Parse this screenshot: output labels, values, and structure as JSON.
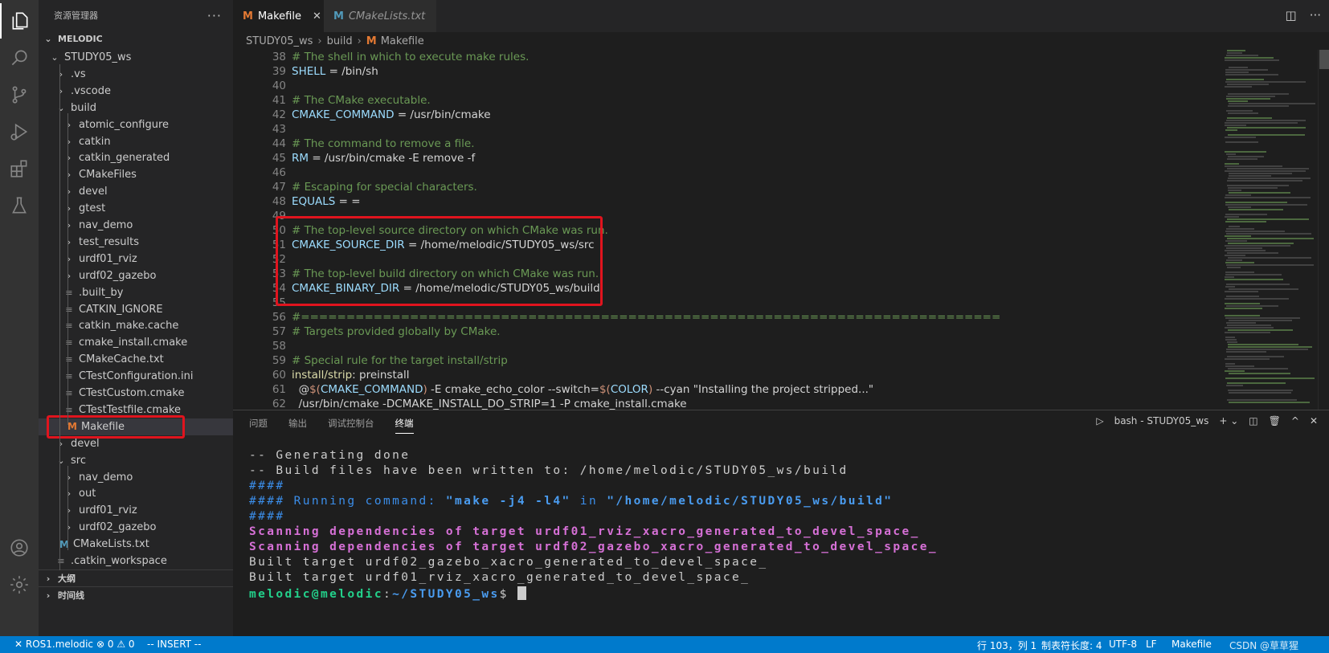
{
  "activity_bar": {
    "icons": [
      "explorer-icon",
      "search-icon",
      "source-control-icon",
      "run-debug-icon",
      "extensions-icon",
      "testing-icon",
      "account-icon",
      "settings-gear-icon"
    ]
  },
  "sidebar": {
    "title": "资源管理器",
    "more": "···",
    "workspace": "MELODIC",
    "tree": [
      {
        "label": "STUDY05_ws",
        "chev": "⌄",
        "depth": 1
      },
      {
        "label": ".vs",
        "chev": "›",
        "depth": 2
      },
      {
        "label": ".vscode",
        "chev": "›",
        "depth": 2
      },
      {
        "label": "build",
        "chev": "⌄",
        "depth": 2
      },
      {
        "label": "atomic_configure",
        "chev": "›",
        "depth": 3
      },
      {
        "label": "catkin",
        "chev": "›",
        "depth": 3
      },
      {
        "label": "catkin_generated",
        "chev": "›",
        "depth": 3
      },
      {
        "label": "CMakeFiles",
        "chev": "›",
        "depth": 3
      },
      {
        "label": "devel",
        "chev": "›",
        "depth": 3
      },
      {
        "label": "gtest",
        "chev": "›",
        "depth": 3
      },
      {
        "label": "nav_demo",
        "chev": "›",
        "depth": 3
      },
      {
        "label": "test_results",
        "chev": "›",
        "depth": 3
      },
      {
        "label": "urdf01_rviz",
        "chev": "›",
        "depth": 3
      },
      {
        "label": "urdf02_gazebo",
        "chev": "›",
        "depth": 3
      },
      {
        "label": ".built_by",
        "chev": "≡",
        "depth": 3
      },
      {
        "label": "CATKIN_IGNORE",
        "chev": "≡",
        "depth": 3
      },
      {
        "label": "catkin_make.cache",
        "chev": "≡",
        "depth": 3
      },
      {
        "label": "cmake_install.cmake",
        "chev": "≡",
        "depth": 3
      },
      {
        "label": "CMakeCache.txt",
        "chev": "≡",
        "depth": 3
      },
      {
        "label": "CTestConfiguration.ini",
        "chev": "≡",
        "depth": 3
      },
      {
        "label": "CTestCustom.cmake",
        "chev": "≡",
        "depth": 3
      },
      {
        "label": "CTestTestfile.cmake",
        "chev": "≡",
        "depth": 3
      },
      {
        "label": "Makefile",
        "chev": "M",
        "depth": 3,
        "selected": true
      },
      {
        "label": "devel",
        "chev": "›",
        "depth": 2
      },
      {
        "label": "src",
        "chev": "⌄",
        "depth": 2
      },
      {
        "label": "nav_demo",
        "chev": "›",
        "depth": 3
      },
      {
        "label": "out",
        "chev": "›",
        "depth": 3
      },
      {
        "label": "urdf01_rviz",
        "chev": "›",
        "depth": 3
      },
      {
        "label": "urdf02_gazebo",
        "chev": "›",
        "depth": 3
      },
      {
        "label": "CMakeLists.txt",
        "chev": "M",
        "depth": 2,
        "blue": true
      },
      {
        "label": ".catkin_workspace",
        "chev": "≡",
        "depth": 2
      }
    ],
    "outline": "大纲",
    "timeline": "时间线"
  },
  "tabs": [
    {
      "label": "Makefile",
      "icon": "M",
      "active": true
    },
    {
      "label": "CMakeLists.txt",
      "icon": "M",
      "active": false
    }
  ],
  "tab_close": "✕",
  "breadcrumb": [
    "STUDY05_ws",
    "build",
    "Makefile"
  ],
  "code_lines": [
    {
      "n": "38",
      "parts": [
        {
          "t": "# The shell in which to execute make rules.",
          "c": "c-comment"
        }
      ]
    },
    {
      "n": "39",
      "parts": [
        {
          "t": "SHELL",
          "c": "c-var"
        },
        {
          "t": " = /bin/sh",
          "c": "c-plain"
        }
      ]
    },
    {
      "n": "40",
      "parts": []
    },
    {
      "n": "41",
      "parts": [
        {
          "t": "# The CMake executable.",
          "c": "c-comment"
        }
      ]
    },
    {
      "n": "42",
      "parts": [
        {
          "t": "CMAKE_COMMAND",
          "c": "c-var"
        },
        {
          "t": " = /usr/bin/cmake",
          "c": "c-plain"
        }
      ]
    },
    {
      "n": "43",
      "parts": []
    },
    {
      "n": "44",
      "parts": [
        {
          "t": "# The command to remove a file.",
          "c": "c-comment"
        }
      ]
    },
    {
      "n": "45",
      "parts": [
        {
          "t": "RM",
          "c": "c-var"
        },
        {
          "t": " = /usr/bin/cmake -E remove -f",
          "c": "c-plain"
        }
      ]
    },
    {
      "n": "46",
      "parts": []
    },
    {
      "n": "47",
      "parts": [
        {
          "t": "# Escaping for special characters.",
          "c": "c-comment"
        }
      ]
    },
    {
      "n": "48",
      "parts": [
        {
          "t": "EQUALS",
          "c": "c-var"
        },
        {
          "t": " = =",
          "c": "c-plain"
        }
      ]
    },
    {
      "n": "49",
      "parts": []
    },
    {
      "n": "50",
      "parts": [
        {
          "t": "# The top-level source directory on which CMake was run.",
          "c": "c-comment"
        }
      ]
    },
    {
      "n": "51",
      "parts": [
        {
          "t": "CMAKE_SOURCE_DIR",
          "c": "c-var"
        },
        {
          "t": " = /home/melodic/STUDY05_ws/src",
          "c": "c-plain"
        }
      ]
    },
    {
      "n": "52",
      "parts": []
    },
    {
      "n": "53",
      "parts": [
        {
          "t": "# The top-level build directory on which CMake was run.",
          "c": "c-comment"
        }
      ]
    },
    {
      "n": "54",
      "parts": [
        {
          "t": "CMAKE_BINARY_DIR",
          "c": "c-var"
        },
        {
          "t": " = /home/melodic/STUDY05_ws/build",
          "c": "c-plain"
        }
      ]
    },
    {
      "n": "55",
      "parts": []
    },
    {
      "n": "56",
      "parts": [
        {
          "t": "#=============================================================================",
          "c": "c-comment"
        }
      ]
    },
    {
      "n": "57",
      "parts": [
        {
          "t": "# Targets provided globally by CMake.",
          "c": "c-comment"
        }
      ]
    },
    {
      "n": "58",
      "parts": []
    },
    {
      "n": "59",
      "parts": [
        {
          "t": "# Special rule for the target install/strip",
          "c": "c-comment"
        }
      ]
    },
    {
      "n": "60",
      "parts": [
        {
          "t": "install/strip",
          "c": "c-macro"
        },
        {
          "t": ": preinstall",
          "c": "c-plain"
        }
      ]
    },
    {
      "n": "61",
      "parts": [
        {
          "t": "  @",
          "c": "c-plain"
        },
        {
          "t": "$(",
          "c": "c-str"
        },
        {
          "t": "CMAKE_COMMAND",
          "c": "c-var"
        },
        {
          "t": ")",
          "c": "c-str"
        },
        {
          "t": " -E cmake_echo_color --switch=",
          "c": "c-plain"
        },
        {
          "t": "$(",
          "c": "c-str"
        },
        {
          "t": "COLOR",
          "c": "c-var"
        },
        {
          "t": ")",
          "c": "c-str"
        },
        {
          "t": " --cyan \"Installing the project stripped...\"",
          "c": "c-plain"
        }
      ]
    },
    {
      "n": "62",
      "parts": [
        {
          "t": "  /usr/bin/cmake -DCMAKE_INSTALL_DO_STRIP=1 -P cmake_install.cmake",
          "c": "c-plain"
        }
      ]
    }
  ],
  "panel": {
    "tabs": [
      "问题",
      "输出",
      "调试控制台",
      "终端"
    ],
    "active_tab": "终端",
    "terminal_name": "bash - STUDY05_ws"
  },
  "terminal_lines": [
    [
      {
        "t": "-- Generating done",
        "c": "t-plain"
      }
    ],
    [
      {
        "t": "-- Build files have been written to: /home/melodic/STUDY05_ws/build",
        "c": "t-plain"
      }
    ],
    [
      {
        "t": "####",
        "c": "t-hash"
      }
    ],
    [
      {
        "t": "#### Running command: ",
        "c": "t-blue"
      },
      {
        "t": "\"make -j4 -l4\"",
        "c": "t-bold-blue"
      },
      {
        "t": " in ",
        "c": "t-blue"
      },
      {
        "t": "\"/home/melodic/STUDY05_ws/build\"",
        "c": "t-bold-blue"
      }
    ],
    [
      {
        "t": "####",
        "c": "t-hash"
      }
    ],
    [
      {
        "t": "Scanning dependencies of target urdf01_rviz_xacro_generated_to_devel_space_",
        "c": "t-magenta"
      }
    ],
    [
      {
        "t": "Scanning dependencies of target urdf02_gazebo_xacro_generated_to_devel_space_",
        "c": "t-magenta"
      }
    ],
    [
      {
        "t": "Built target urdf02_gazebo_xacro_generated_to_devel_space_",
        "c": "t-plain"
      }
    ],
    [
      {
        "t": "Built target urdf01_rviz_xacro_generated_to_devel_space_",
        "c": "t-plain"
      }
    ],
    [
      {
        "t": "melodic@melodic",
        "c": "t-green"
      },
      {
        "t": ":",
        "c": "t-plain"
      },
      {
        "t": "~/STUDY05_ws",
        "c": "t-bold-blue"
      },
      {
        "t": "$ ",
        "c": "t-plain"
      }
    ]
  ],
  "statusbar": {
    "remote": "✕ ROS1.melodic",
    "problems": "⊗ 0 ⚠ 0",
    "mode": "-- INSERT --",
    "position": "行 103，列 1",
    "tab_size": "制表符长度: 4",
    "encoding": "UTF-8",
    "eol": "LF",
    "language": "Makefile",
    "watermark": "CSDN @草草猩"
  }
}
